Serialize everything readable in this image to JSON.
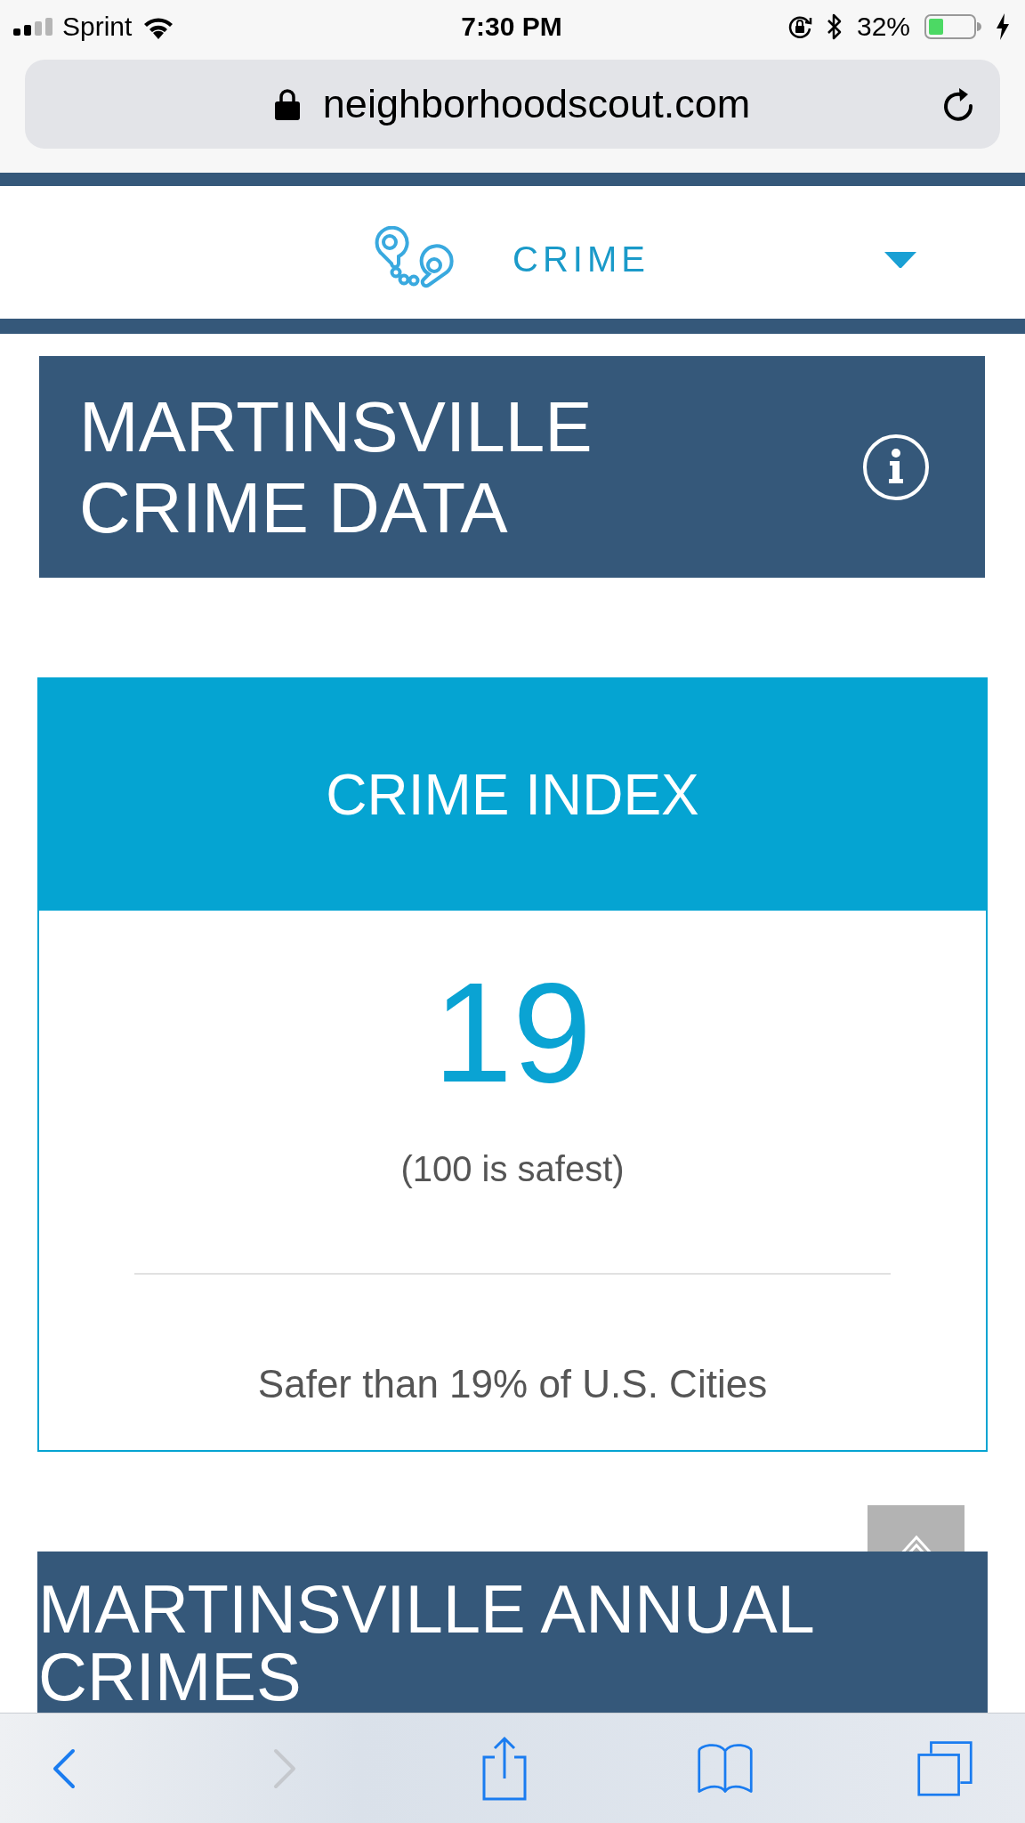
{
  "status_bar": {
    "carrier": "Sprint",
    "time": "7:30 PM",
    "battery": "32%"
  },
  "address_bar": {
    "url": "neighborhoodscout.com"
  },
  "section_nav": {
    "label": "CRIME"
  },
  "title_banner": {
    "title": "MARTINSVILLE CRIME DATA"
  },
  "crime_index": {
    "title": "CRIME INDEX",
    "value": "19",
    "note": "(100 is safest)",
    "comparison": "Safer than 19% of U.S. Cities"
  },
  "annual_banner": {
    "title": "MARTINSVILLE ANNUAL CRIMES"
  },
  "toolbar": {
    "buttons": [
      {
        "kind": "back",
        "disabled": false
      },
      {
        "kind": "forward",
        "disabled": true
      },
      {
        "kind": "share",
        "disabled": false
      },
      {
        "kind": "bookmarks",
        "disabled": false
      },
      {
        "kind": "tabs",
        "disabled": false
      }
    ]
  }
}
